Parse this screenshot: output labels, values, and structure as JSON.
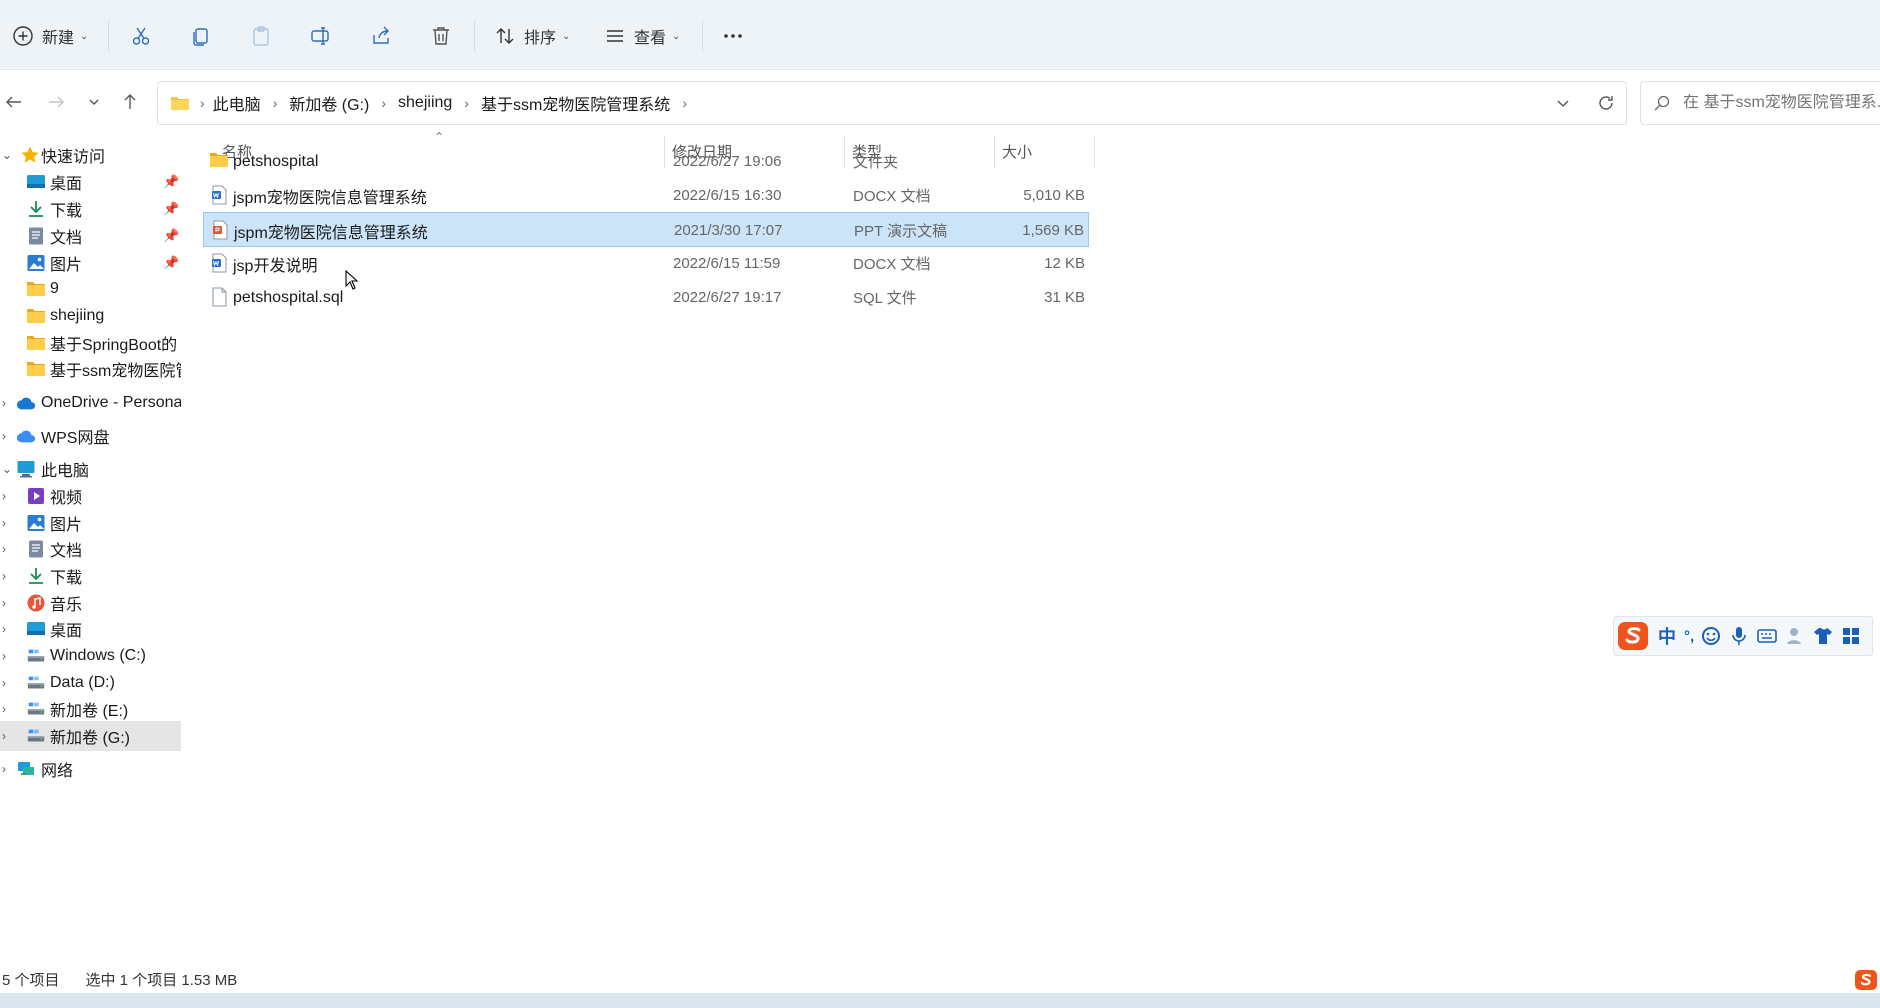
{
  "toolbar": {
    "new_label": "新建",
    "sort_label": "排序",
    "view_label": "查看"
  },
  "address": {
    "crumbs": [
      "此电脑",
      "新加卷 (G:)",
      "shejiing",
      "基于ssm宠物医院管理系统"
    ]
  },
  "search": {
    "placeholder": "在 基于ssm宠物医院管理系..."
  },
  "sidebar": {
    "items": [
      {
        "label": "快速访问",
        "icon": "star-icon"
      },
      {
        "label": "桌面",
        "icon": "desktop-icon",
        "pinned": true
      },
      {
        "label": "下载",
        "icon": "download-icon",
        "pinned": true
      },
      {
        "label": "文档",
        "icon": "document-icon",
        "pinned": true
      },
      {
        "label": "图片",
        "icon": "pictures-icon",
        "pinned": true
      },
      {
        "label": "9",
        "icon": "folder-icon"
      },
      {
        "label": "shejiing",
        "icon": "folder-icon"
      },
      {
        "label": "基于SpringBoot的",
        "icon": "folder-icon"
      },
      {
        "label": "基于ssm宠物医院管",
        "icon": "folder-icon"
      },
      {
        "label": "OneDrive - Persona",
        "icon": "cloud-icon"
      },
      {
        "label": "WPS网盘",
        "icon": "cloud-icon"
      },
      {
        "label": "此电脑",
        "icon": "computer-icon"
      },
      {
        "label": "视频",
        "icon": "video-icon"
      },
      {
        "label": "图片",
        "icon": "pictures-icon"
      },
      {
        "label": "文档",
        "icon": "document-icon"
      },
      {
        "label": "下载",
        "icon": "download-icon"
      },
      {
        "label": "音乐",
        "icon": "music-icon"
      },
      {
        "label": "桌面",
        "icon": "desktop-icon"
      },
      {
        "label": "Windows (C:)",
        "icon": "drive-icon"
      },
      {
        "label": "Data (D:)",
        "icon": "drive-icon"
      },
      {
        "label": "新加卷 (E:)",
        "icon": "drive-icon"
      },
      {
        "label": "新加卷 (G:)",
        "icon": "drive-icon",
        "selected": true
      },
      {
        "label": "网络",
        "icon": "network-icon"
      }
    ]
  },
  "columns": {
    "name": "名称",
    "date": "修改日期",
    "type": "类型",
    "size": "大小"
  },
  "files": [
    {
      "name": "petshospital",
      "date": "2022/6/27 19:06",
      "type": "文件夹",
      "size": "",
      "icon": "folder-icon"
    },
    {
      "name": "jspm宠物医院信息管理系统",
      "date": "2022/6/15 16:30",
      "type": "DOCX 文档",
      "size": "5,010 KB",
      "icon": "word-doc-icon"
    },
    {
      "name": "jspm宠物医院信息管理系统",
      "date": "2021/3/30 17:07",
      "type": "PPT 演示文稿",
      "size": "1,569 KB",
      "icon": "ppt-icon",
      "selected": true
    },
    {
      "name": "jsp开发说明",
      "date": "2022/6/15 11:59",
      "type": "DOCX 文档",
      "size": "12 KB",
      "icon": "word-doc-icon"
    },
    {
      "name": "petshospital.sql",
      "date": "2022/6/27 19:17",
      "type": "SQL 文件",
      "size": "31 KB",
      "icon": "file-icon"
    }
  ],
  "status": {
    "count": "5 个项目",
    "selection": "选中 1 个项目  1.53 MB"
  },
  "ime": {
    "mode": "中",
    "punct": "°,"
  },
  "colors": {
    "toolbar_bg": "#eef3f8",
    "selected_row": "#cce4f7",
    "folder": "#f6c444",
    "accent": "#0067c0"
  }
}
